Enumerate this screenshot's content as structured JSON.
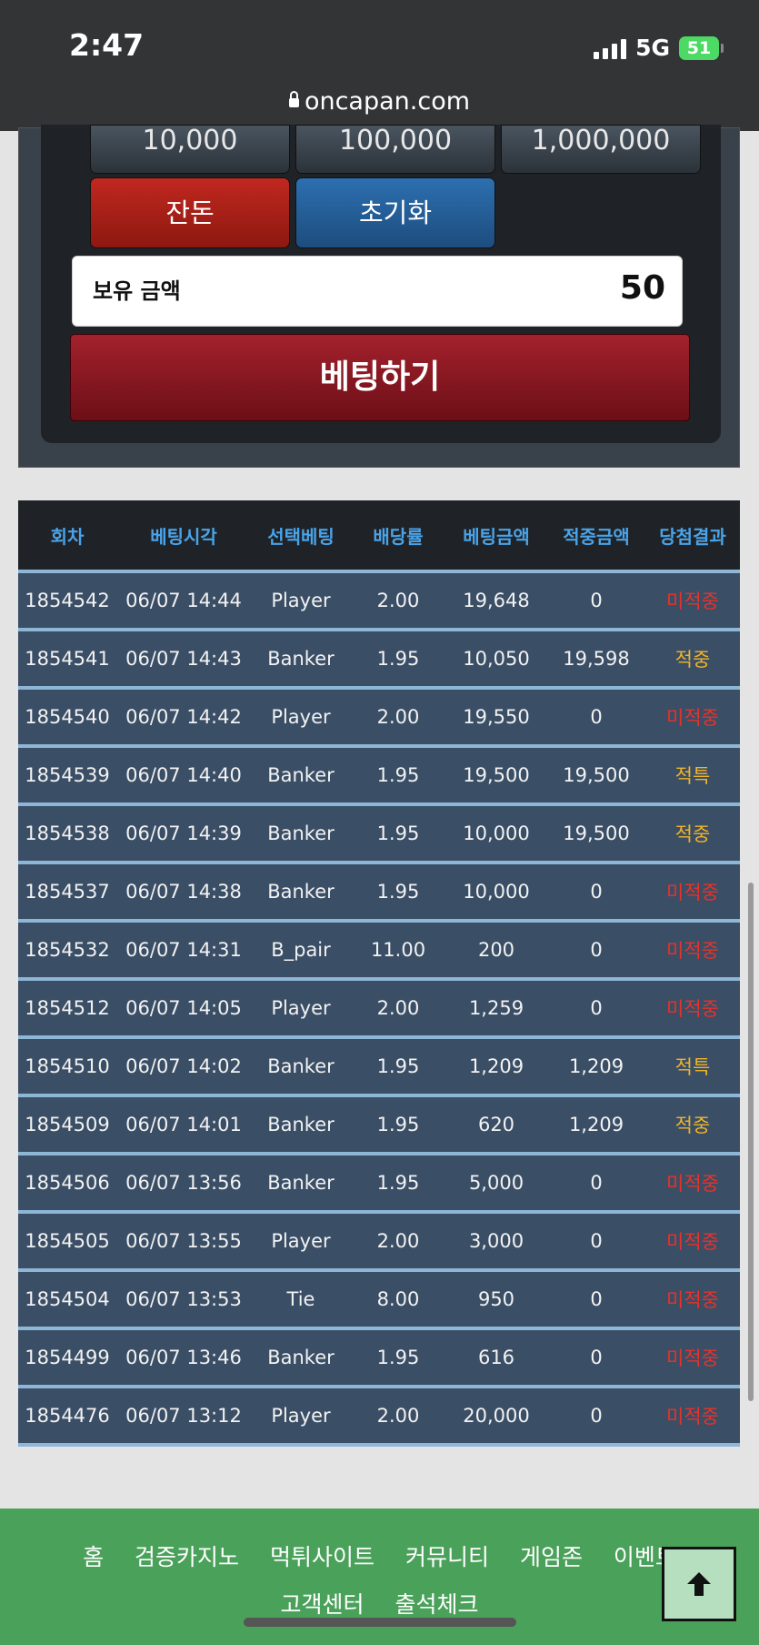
{
  "status_bar": {
    "time": "2:47",
    "network": "5G",
    "battery": "51"
  },
  "browser": {
    "url": "oncapan.com"
  },
  "chips": [
    "10,000",
    "100,000",
    "1,000,000"
  ],
  "actions": {
    "change": "잔돈",
    "reset": "초기화"
  },
  "balance": {
    "label": "보유 금액",
    "value": "50"
  },
  "bet_button": "베팅하기",
  "table": {
    "headers": [
      "회차",
      "베팅시각",
      "선택베팅",
      "배당률",
      "베팅금액",
      "적중금액",
      "당첨결과"
    ],
    "rows": [
      [
        "1854542",
        "06/07 14:44",
        "Player",
        "2.00",
        "19,648",
        "0",
        "미적중"
      ],
      [
        "1854541",
        "06/07 14:43",
        "Banker",
        "1.95",
        "10,050",
        "19,598",
        "적중"
      ],
      [
        "1854540",
        "06/07 14:42",
        "Player",
        "2.00",
        "19,550",
        "0",
        "미적중"
      ],
      [
        "1854539",
        "06/07 14:40",
        "Banker",
        "1.95",
        "19,500",
        "19,500",
        "적특"
      ],
      [
        "1854538",
        "06/07 14:39",
        "Banker",
        "1.95",
        "10,000",
        "19,500",
        "적중"
      ],
      [
        "1854537",
        "06/07 14:38",
        "Banker",
        "1.95",
        "10,000",
        "0",
        "미적중"
      ],
      [
        "1854532",
        "06/07 14:31",
        "B_pair",
        "11.00",
        "200",
        "0",
        "미적중"
      ],
      [
        "1854512",
        "06/07 14:05",
        "Player",
        "2.00",
        "1,259",
        "0",
        "미적중"
      ],
      [
        "1854510",
        "06/07 14:02",
        "Banker",
        "1.95",
        "1,209",
        "1,209",
        "적특"
      ],
      [
        "1854509",
        "06/07 14:01",
        "Banker",
        "1.95",
        "620",
        "1,209",
        "적중"
      ],
      [
        "1854506",
        "06/07 13:56",
        "Banker",
        "1.95",
        "5,000",
        "0",
        "미적중"
      ],
      [
        "1854505",
        "06/07 13:55",
        "Player",
        "2.00",
        "3,000",
        "0",
        "미적중"
      ],
      [
        "1854504",
        "06/07 13:53",
        "Tie",
        "8.00",
        "950",
        "0",
        "미적중"
      ],
      [
        "1854499",
        "06/07 13:46",
        "Banker",
        "1.95",
        "616",
        "0",
        "미적중"
      ],
      [
        "1854476",
        "06/07 13:12",
        "Player",
        "2.00",
        "20,000",
        "0",
        "미적중"
      ]
    ]
  },
  "footer": {
    "nav": [
      "홈",
      "검증카지노",
      "먹튀사이트",
      "커뮤니티",
      "게임존",
      "이벤트",
      "고객센터",
      "출석체크"
    ]
  },
  "colors": {
    "miss": "#e8322a",
    "hit": "#f0b429",
    "footer": "#4aa15a"
  }
}
